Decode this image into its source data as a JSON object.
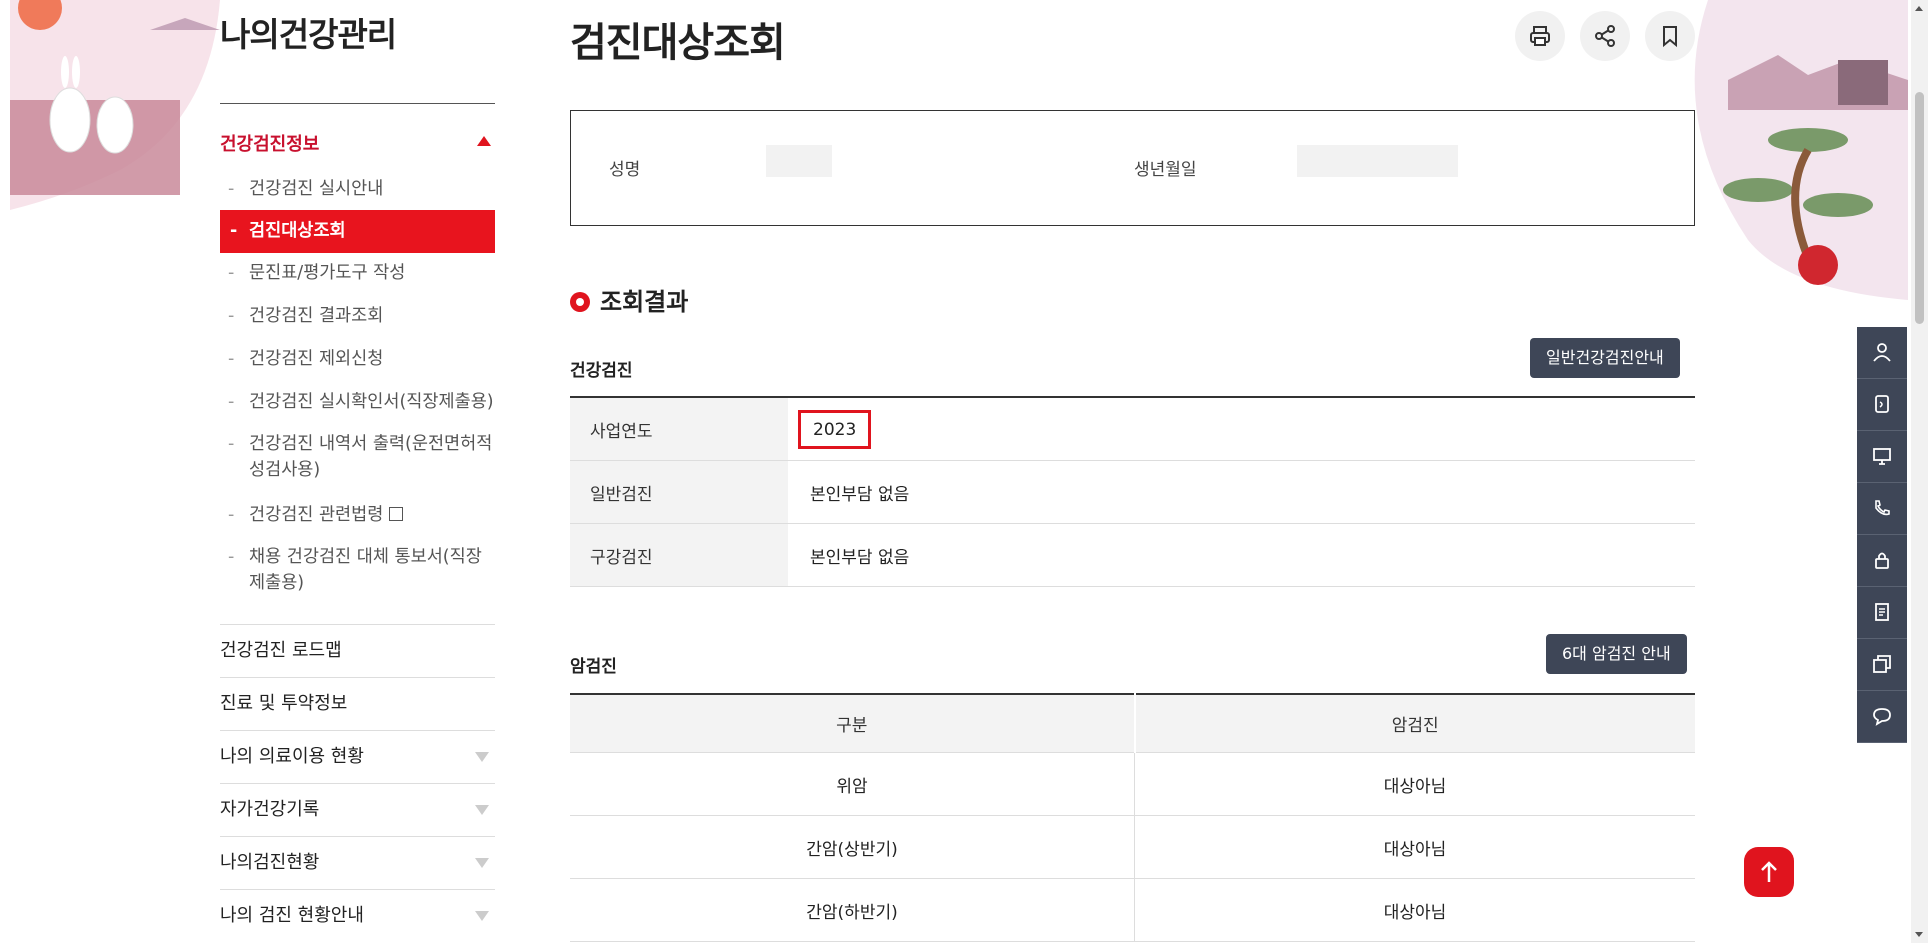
{
  "sidebar": {
    "title": "나의건강관리",
    "section": "건강검진정보",
    "items": [
      {
        "label": "건강검진 실시안내"
      },
      {
        "label": "검진대상조회"
      },
      {
        "label": "문진표/평가도구 작성"
      },
      {
        "label": "건강검진 결과조회"
      },
      {
        "label": "건강검진 제외신청"
      },
      {
        "label": "건강검진 실시확인서(직장제출용)"
      },
      {
        "label": "건강검진 내역서 출력(운전면허적성검사용)"
      },
      {
        "label": "건강검진 관련법령"
      },
      {
        "label": "채용 건강검진 대체 통보서(직장제출용)"
      }
    ],
    "menus": [
      {
        "label": "건강검진 로드맵"
      },
      {
        "label": "진료 및 투약정보"
      },
      {
        "label": "나의 의료이용 현황"
      },
      {
        "label": "자가건강기록"
      },
      {
        "label": "나의검진현황"
      },
      {
        "label": "나의 검진 현황안내"
      }
    ]
  },
  "page": {
    "title": "검진대상조회",
    "tools": [
      "print-icon",
      "share-icon",
      "bookmark-icon"
    ]
  },
  "info": {
    "name_label": "성명",
    "birth_label": "생년월일"
  },
  "result": {
    "heading": "조회결과",
    "health": {
      "title": "건강검진",
      "guide_button": "일반건강검진안내",
      "rows": [
        {
          "label": "사업연도",
          "value": "2023"
        },
        {
          "label": "일반검진",
          "value": "본인부담 없음"
        },
        {
          "label": "구강검진",
          "value": "본인부담 없음"
        }
      ]
    },
    "cancer": {
      "title": "암검진",
      "guide_button": "6대 암검진 안내",
      "headers": [
        "구분",
        "암검진"
      ],
      "rows": [
        {
          "type": "위암",
          "status": "대상아님"
        },
        {
          "type": "간암(상반기)",
          "status": "대상아님"
        },
        {
          "type": "간암(하반기)",
          "status": "대상아님"
        }
      ]
    }
  },
  "quick_menu": [
    "user-icon",
    "mobile-icon",
    "monitor-icon",
    "phone-icon",
    "lock-icon",
    "document-icon",
    "windows-icon",
    "chat-icon"
  ],
  "colors": {
    "accent": "#e0141e",
    "dark": "#3e4657"
  }
}
